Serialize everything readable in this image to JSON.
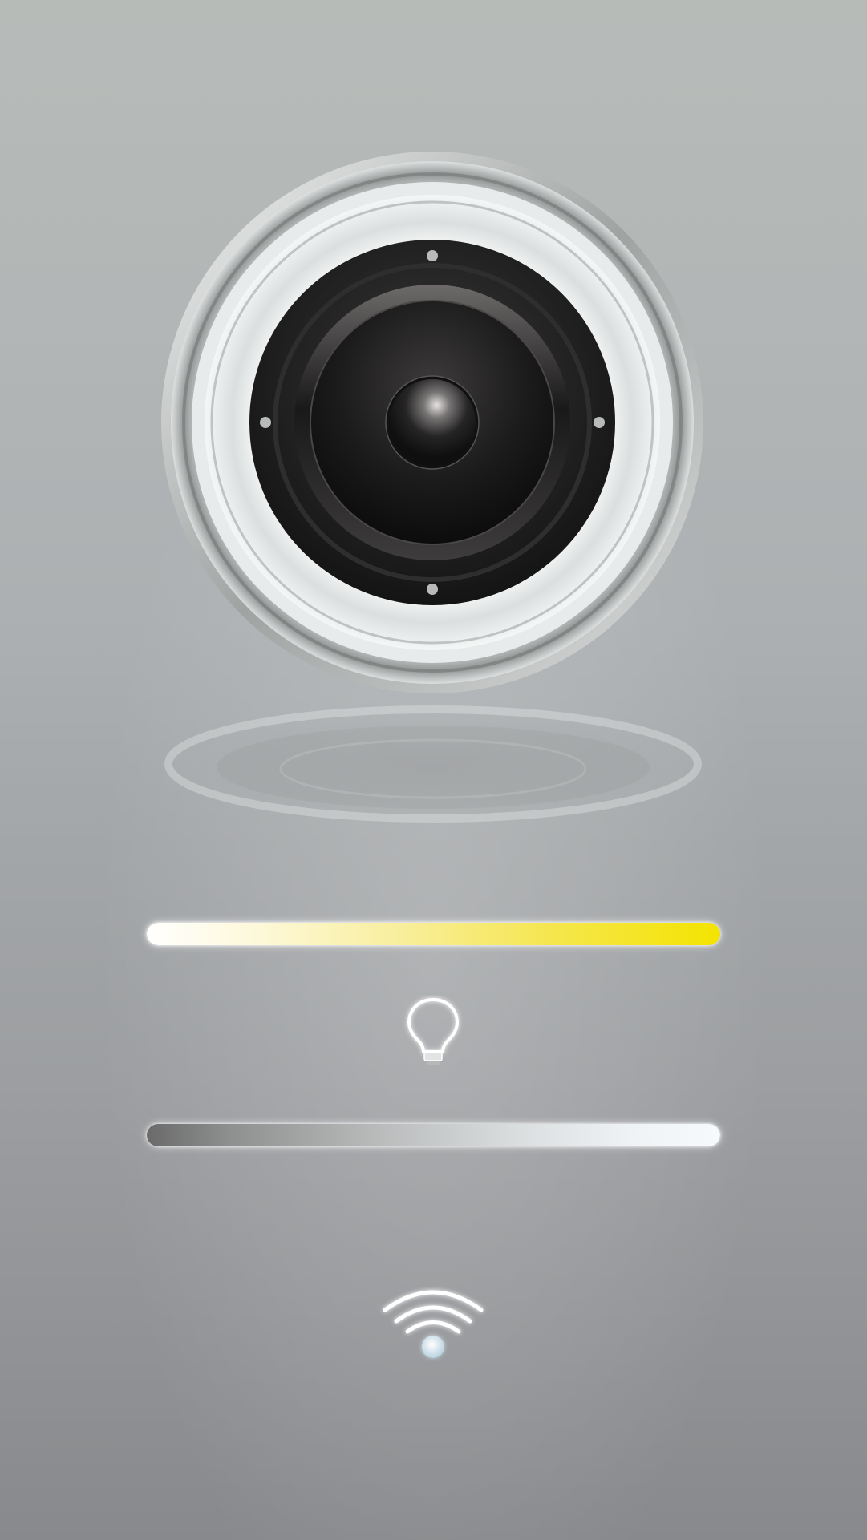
{
  "app": {
    "name": "speaker-light-control"
  },
  "speaker": {
    "icon": "speaker-icon"
  },
  "brightness_slider": {
    "icon": "brightness-slider",
    "value_percent": 100,
    "colors": {
      "start": "#ffffff",
      "end": "#f4e400"
    }
  },
  "light": {
    "icon": "light-bulb-icon"
  },
  "color_slider": {
    "icon": "color-temperature-slider",
    "value_percent": 100,
    "colors": {
      "start": "#6a6a6a",
      "end": "#f7fafc"
    }
  },
  "wifi": {
    "icon": "wifi-icon",
    "glow_color": "#dfeef8"
  },
  "colors": {
    "background_top": "#b7bbb8",
    "background_bottom": "#87898c"
  }
}
